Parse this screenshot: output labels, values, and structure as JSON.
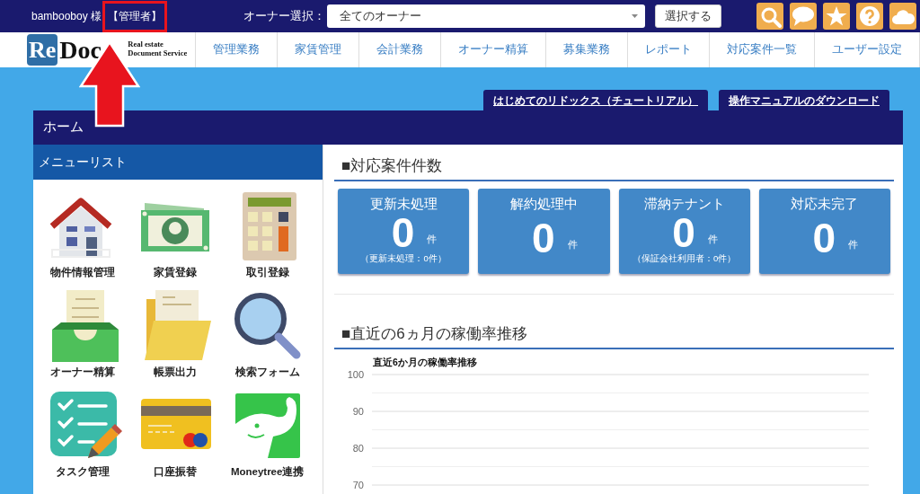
{
  "header": {
    "user": "bambooboy 様",
    "role": "【管理者】",
    "role_highlighted": true,
    "owner_label": "オーナー選択：",
    "owner_select": {
      "value": "全てのオーナー"
    },
    "select_button": "選択する"
  },
  "annotation": {
    "arrow": true
  },
  "logo": {
    "mark": "Re",
    "word": "Doc",
    "tagline": [
      "Real estate",
      "Document Service"
    ]
  },
  "nav": [
    "管理業務",
    "家賃管理",
    "会計業務",
    "オーナー精算",
    "募集業務",
    "レポート",
    "対応案件一覧",
    "ユーザー設定"
  ],
  "tabs": [
    "はじめてのリドックス（チュートリアル）",
    "操作マニュアルのダウンロード"
  ],
  "page_title": "ホーム",
  "menu": {
    "title": "メニューリスト",
    "items": [
      {
        "label": "物件情報管理",
        "kind": "house"
      },
      {
        "label": "家賃登録",
        "kind": "money"
      },
      {
        "label": "取引登録",
        "kind": "calculator"
      },
      {
        "label": "オーナー精算",
        "kind": "tray"
      },
      {
        "label": "帳票出力",
        "kind": "folder"
      },
      {
        "label": "検索フォーム",
        "kind": "magnifier"
      },
      {
        "label": "タスク管理",
        "kind": "checklist"
      },
      {
        "label": "口座振替",
        "kind": "card"
      },
      {
        "label": "Moneytree連携",
        "kind": "elephant"
      }
    ]
  },
  "cases": {
    "title": "■対応案件件数",
    "cards": [
      {
        "label": "更新未処理",
        "count": "0",
        "unit": "件",
        "note": "（更新未処理：0件）"
      },
      {
        "label": "解約処理中",
        "count": "0",
        "unit": "件"
      },
      {
        "label": "滞納テナント",
        "count": "0",
        "unit": "件",
        "note": "（保証会社利用者：0件）"
      },
      {
        "label": "対応未完了",
        "count": "0",
        "unit": "件"
      }
    ]
  },
  "trend": {
    "title": "■直近の6ヵ月の稼働率推移",
    "chart_title": "直近6か月の稼働率推移",
    "axis_labels": [
      "100",
      "90",
      "80",
      "70"
    ]
  }
}
